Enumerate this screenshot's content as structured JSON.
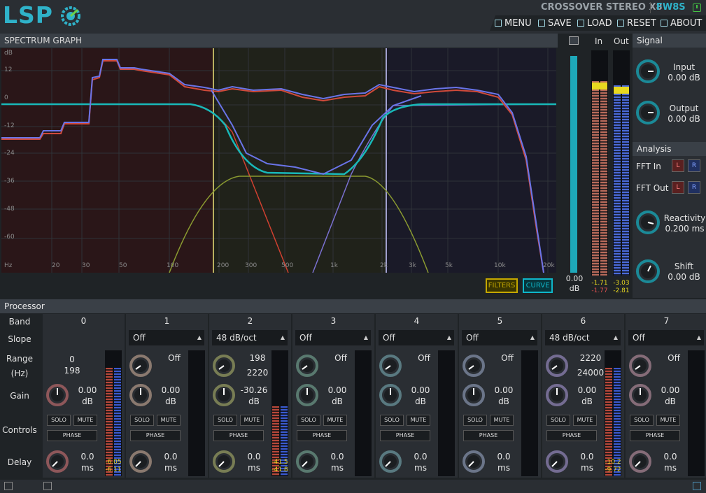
{
  "header": {
    "logo": "LSP",
    "title": "CROSSOVER STEREO X8",
    "version": "FW8S",
    "menu": [
      {
        "label": "MENU",
        "icon": "menu-icon"
      },
      {
        "label": "SAVE",
        "icon": "save-icon"
      },
      {
        "label": "LOAD",
        "icon": "load-icon"
      },
      {
        "label": "RESET",
        "icon": "reset-icon"
      },
      {
        "label": "ABOUT",
        "icon": "about-icon"
      }
    ]
  },
  "graph": {
    "title": "SPECTRUM GRAPH",
    "db_labels": [
      "dB",
      "12",
      "0",
      "-12",
      "-24",
      "-36",
      "-48",
      "-60"
    ],
    "freq_labels": [
      "Hz",
      "20",
      "30",
      "50",
      "100",
      "200",
      "300",
      "500",
      "1k",
      "2k",
      "3k",
      "5k",
      "10k",
      "20k"
    ],
    "filters_label": "FILTERS",
    "curve_label": "CURVE",
    "zoom_value": "0.00",
    "zoom_unit": "dB"
  },
  "meters": {
    "in_label": "In",
    "out_label": "Out",
    "in_values": [
      "-1.71",
      "-1.77"
    ],
    "out_values": [
      "-3.03",
      "-2.81"
    ]
  },
  "signal": {
    "title": "Signal",
    "input_label": "Input",
    "input_value": "0.00 dB",
    "output_label": "Output",
    "output_value": "0.00 dB"
  },
  "analysis": {
    "title": "Analysis",
    "fft_in": "FFT In",
    "fft_out": "FFT Out",
    "l": "L",
    "r": "R",
    "reactivity_label": "Reactivity",
    "reactivity_value": "0.200 ms",
    "shift_label": "Shift",
    "shift_value": "0.00 dB"
  },
  "processor": {
    "title": "Processor",
    "row_labels": {
      "band": "Band",
      "slope": "Slope",
      "range": "Range",
      "range_unit": "(Hz)",
      "gain": "Gain",
      "controls": "Controls",
      "delay": "Delay"
    },
    "solo": "SOLO",
    "mute": "MUTE",
    "phase": "PHASE",
    "bands": [
      {
        "num": "0",
        "slope": "",
        "range1": "0",
        "range2": "198",
        "gain": "0.00",
        "gain_unit": "dB",
        "delay": "0.0",
        "delay_unit": "ms",
        "meter": [
          "-6.05",
          "-6.11"
        ],
        "color": "#e07a7a"
      },
      {
        "num": "1",
        "slope": "Off",
        "range1": "Off",
        "range2": "",
        "gain": "0.00",
        "gain_unit": "dB",
        "delay": "0.0",
        "delay_unit": "ms",
        "meter": [
          "",
          ""
        ],
        "color": "#d8b8a0"
      },
      {
        "num": "2",
        "slope": "48 dB/oct",
        "range1": "198",
        "range2": "2220",
        "gain": "-30.26",
        "gain_unit": "dB",
        "delay": "0.0",
        "delay_unit": "ms",
        "meter": [
          "-41.5",
          "-41.8"
        ],
        "color": "#b8c070"
      },
      {
        "num": "3",
        "slope": "Off",
        "range1": "Off",
        "range2": "",
        "gain": "0.00",
        "gain_unit": "dB",
        "delay": "0.0",
        "delay_unit": "ms",
        "meter": [
          "",
          ""
        ],
        "color": "#80b8a0"
      },
      {
        "num": "4",
        "slope": "Off",
        "range1": "Off",
        "range2": "",
        "gain": "0.00",
        "gain_unit": "dB",
        "delay": "0.0",
        "delay_unit": "ms",
        "meter": [
          "",
          ""
        ],
        "color": "#80b8c0"
      },
      {
        "num": "5",
        "slope": "Off",
        "range1": "Off",
        "range2": "",
        "gain": "0.00",
        "gain_unit": "dB",
        "delay": "0.0",
        "delay_unit": "ms",
        "meter": [
          "",
          ""
        ],
        "color": "#a0b0d0"
      },
      {
        "num": "6",
        "slope": "48 dB/oct",
        "range1": "2220",
        "range2": "24000",
        "gain": "0.00",
        "gain_unit": "dB",
        "delay": "0.0",
        "delay_unit": "ms",
        "meter": [
          "-10.2",
          "-9.72"
        ],
        "color": "#b0a0e0"
      },
      {
        "num": "7",
        "slope": "Off",
        "range1": "Off",
        "range2": "",
        "gain": "0.00",
        "gain_unit": "dB",
        "delay": "0.0",
        "delay_unit": "ms",
        "meter": [
          "",
          ""
        ],
        "color": "#d0a0b0"
      }
    ]
  }
}
